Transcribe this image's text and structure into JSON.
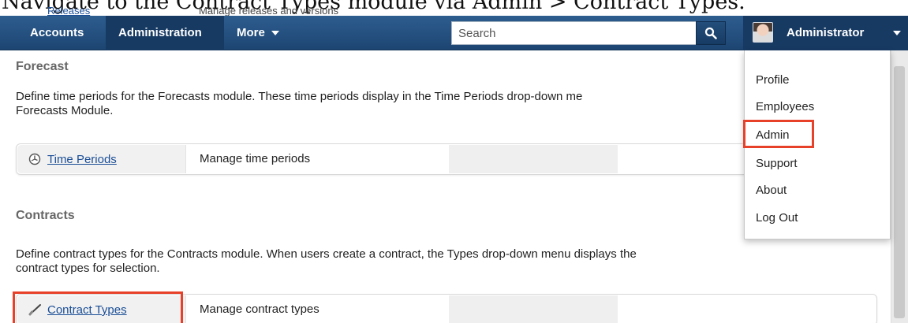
{
  "caption": "Navigate to the Contract Types module via Admin > Contract Types.",
  "behind_banner": {
    "link": "Releases",
    "desc": "Manage releases and versions"
  },
  "navbar": {
    "items": [
      {
        "label": "Accounts"
      },
      {
        "label": "Administration"
      },
      {
        "label": "More"
      }
    ],
    "search_placeholder": "Search",
    "user_name": "Administrator"
  },
  "user_menu": {
    "items": [
      "Profile",
      "Employees",
      "Admin",
      "Support",
      "About",
      "Log Out"
    ]
  },
  "sections": {
    "forecast": {
      "title": "Forecast",
      "desc_line1": "Define time periods for the Forecasts module. These time periods display in the Time Periods drop-down me",
      "desc_line2": "Forecasts Module.",
      "module_link": "Time Periods",
      "module_desc": "Manage time periods"
    },
    "contracts": {
      "title": "Contracts",
      "desc_line1": "Define contract types for the Contracts module. When users create a contract, the Types drop-down menu displays the",
      "desc_line2": "contract types for selection.",
      "module_link": "Contract Types",
      "module_desc": "Manage contract types"
    }
  },
  "colors": {
    "navbar": "#1d4572",
    "highlight": "#e8412a",
    "link": "#1a4e96"
  }
}
